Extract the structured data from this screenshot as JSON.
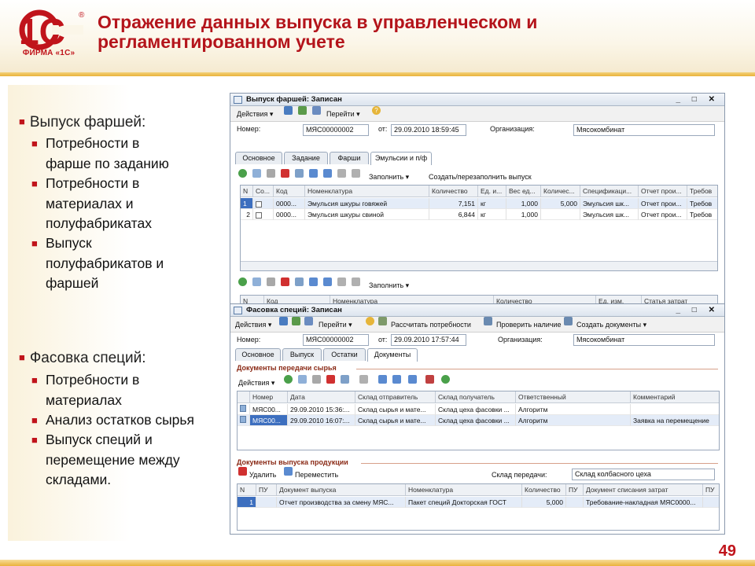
{
  "slide": {
    "logo_text": "1С",
    "logo_sub": "ФИРМА «1С»",
    "title_line1": "Отражение данных выпуска в управленческом и",
    "title_line2": "регламентированном учете",
    "page_number": "49",
    "accent_color": "#c0141b"
  },
  "bullets": {
    "group1": {
      "title": "Выпуск фаршей:",
      "items": [
        {
          "line1": " Потребности в",
          "line2": "фарше по заданию"
        },
        {
          "line1": "Потребности в",
          "line2": "материалах и",
          "line3": "полуфабрикатах"
        },
        {
          "line1": " Выпуск",
          "line2": "полуфабрикатов и",
          "line3": "фаршей"
        }
      ]
    },
    "group2": {
      "title": "Фасовка специй:",
      "items": [
        {
          "line1": "Потребности в",
          "line2": "материалах"
        },
        {
          "line1": "Анализ остатков сырья"
        },
        {
          "line1": "Выпуск специй и",
          "line2": "перемещение между",
          "line3": "складами."
        }
      ]
    }
  },
  "win1": {
    "title": "Выпуск фаршей: Записан",
    "window_controls": "_ □ ✕",
    "toolbar": {
      "actions": "Действия ▾",
      "goto": "Перейти ▾",
      "help": "?"
    },
    "number_label": "Номер:",
    "number": "МЯС00000002",
    "date_label": "от:",
    "date": "29.09.2010 18:59:45",
    "org_label": "Организация:",
    "org": "Мясокомбинат",
    "tabs": [
      "Основное",
      "Задание",
      "Фарши",
      "Эмульсии и п/ф"
    ],
    "table_toolbar": {
      "fill": "Заполнить ▾",
      "create": "Создать/перезаполнить выпуск"
    },
    "columns": [
      "N",
      "Со...",
      "Код",
      "Номенклатура",
      "Количество",
      "Ед. и...",
      "Вес ед...",
      "Количес...",
      "Спецификаци...",
      "Отчет прои...",
      "Требов"
    ],
    "rows": [
      [
        "1",
        "",
        "0000...",
        "Эмульсия шкуры говяжей",
        "7,151",
        "кг",
        "1,000",
        "5,000",
        "Эмульсия шк...",
        "Отчет прои...",
        "Требов"
      ],
      [
        "2",
        "",
        "0000...",
        "Эмульсия шкуры свиной",
        "6,844",
        "кг",
        "1,000",
        "",
        "Эмульсия шк...",
        "Отчет прои...",
        "Требов"
      ]
    ],
    "lower_toolbar": {
      "fill": "Заполнить ▾"
    },
    "lower_columns": [
      "N",
      "Код",
      "Номенклатура",
      "Количество",
      "Ед. изм.",
      "Статья затрат"
    ]
  },
  "win2": {
    "title": "Фасовка специй: Записан",
    "window_controls": "_ □ ✕",
    "toolbar": {
      "actions": "Действия ▾",
      "goto": "Перейти ▾",
      "calc": "Рассчитать потребности",
      "check": "Проверить наличие",
      "create": "Создать документы ▾"
    },
    "number_label": "Номер:",
    "number": "МЯС00000002",
    "date_label": "от:",
    "date": "29.09.2010 17:57:44",
    "org_label": "Организация:",
    "org": "Мясокомбинат",
    "tabs": [
      "Основное",
      "Выпуск",
      "Остатки",
      "Документы"
    ],
    "group1_title": "Документы передачи сырья",
    "group1_toolbar": {
      "actions": "Действия ▾"
    },
    "group1_columns": [
      "",
      "Номер",
      "Дата",
      "Склад отправитель",
      "Склад получатель",
      "Ответственный",
      "Комментарий"
    ],
    "group1_rows": [
      [
        "",
        "МЯС00...",
        "29.09.2010 15:36:...",
        "Склад сырья и мате...",
        "Склад цеха фасовки ...",
        "Алгоритм",
        ""
      ],
      [
        "",
        "МЯС00...",
        "29.09.2010 16:07:...",
        "Склад сырья и мате...",
        "Склад цеха фасовки ...",
        "Алгоритм",
        "Заявка на перемещение"
      ]
    ],
    "group2_title": "Документы выпуска продукции",
    "group2_toolbar": {
      "delete": "Удалить",
      "move": "Переместить",
      "warehouse_label": "Склад передачи:",
      "warehouse": "Склад колбасного цеха"
    },
    "group2_columns": [
      "N",
      "ПУ",
      "Документ выпуска",
      "Номенклатура",
      "Количество",
      "ПУ",
      "Документ списания затрат",
      "ПУ"
    ],
    "group2_rows": [
      [
        "1",
        "",
        "Отчет производства за смену МЯС...",
        "Пакет специй Докторская ГОСТ",
        "5,000",
        "",
        "Требование-накладная МЯС0000...",
        ""
      ]
    ]
  }
}
